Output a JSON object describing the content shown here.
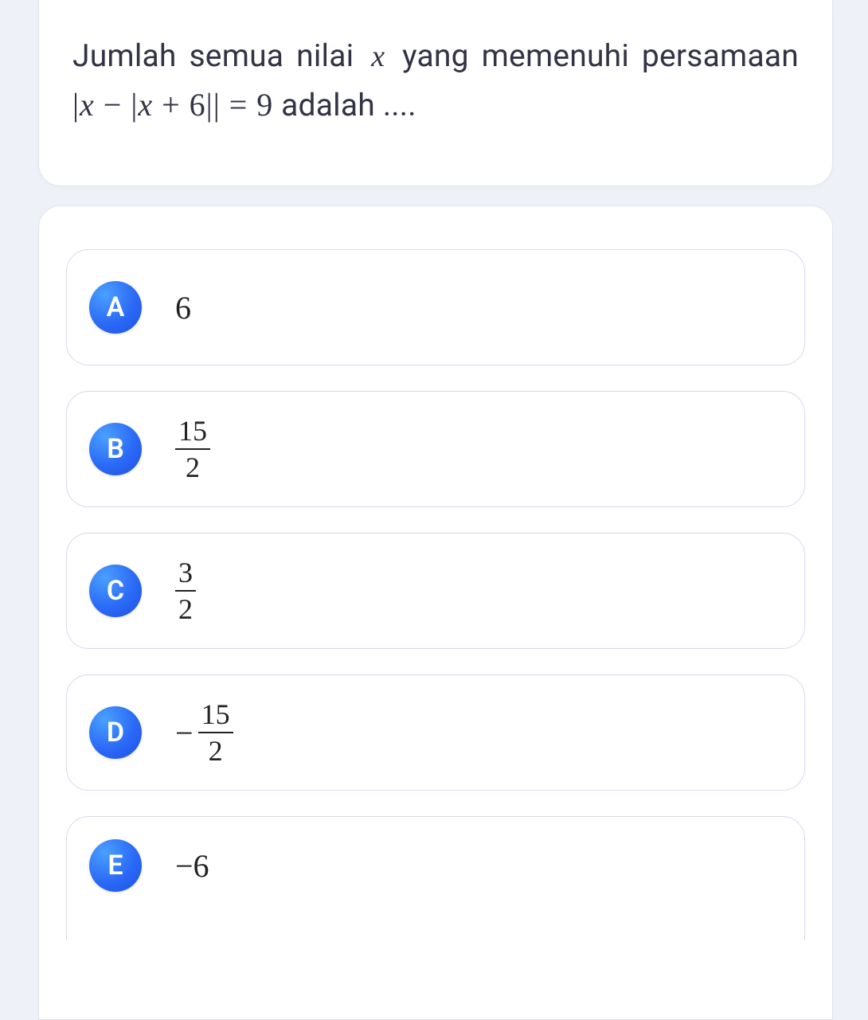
{
  "question": {
    "text_prefix": "Jumlah semua nilai",
    "variable": "x",
    "text_mid": "yang memenuhi persamaan",
    "equation_plain": "|x − |x + 6|| = 9",
    "text_suffix": "adalah ...."
  },
  "options": [
    {
      "letter": "A",
      "type": "plain",
      "value": "6"
    },
    {
      "letter": "B",
      "type": "fraction",
      "sign": "",
      "numerator": "15",
      "denominator": "2"
    },
    {
      "letter": "C",
      "type": "fraction",
      "sign": "",
      "numerator": "3",
      "denominator": "2"
    },
    {
      "letter": "D",
      "type": "fraction",
      "sign": "−",
      "numerator": "15",
      "denominator": "2"
    },
    {
      "letter": "E",
      "type": "plain",
      "value": "−6"
    }
  ]
}
